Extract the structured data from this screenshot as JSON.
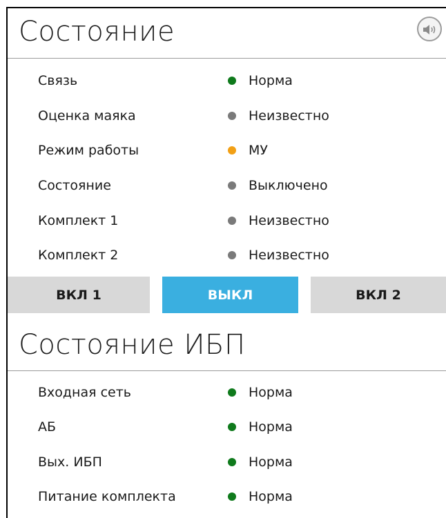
{
  "status_section": {
    "title": "Состояние",
    "rows": [
      {
        "label": "Связь",
        "value": "Норма",
        "state": "ok"
      },
      {
        "label": "Оценка маяка",
        "value": "Неизвестно",
        "state": "unknown"
      },
      {
        "label": "Режим работы",
        "value": "МУ",
        "state": "warn"
      },
      {
        "label": "Состояние",
        "value": "Выключено",
        "state": "unknown"
      },
      {
        "label": "Комплект 1",
        "value": "Неизвестно",
        "state": "unknown"
      },
      {
        "label": "Комплект 2",
        "value": "Неизвестно",
        "state": "unknown"
      }
    ]
  },
  "buttons": {
    "on1": "ВКЛ 1",
    "off": "ВЫКЛ",
    "on2": "ВКЛ 2",
    "active": "off"
  },
  "ups_section": {
    "title": "Состояние ИБП",
    "rows": [
      {
        "label": "Входная сеть",
        "value": "Норма",
        "state": "ok"
      },
      {
        "label": "АБ",
        "value": "Норма",
        "state": "ok"
      },
      {
        "label": "Вых. ИБП",
        "value": "Норма",
        "state": "ok"
      },
      {
        "label": "Питание комплекта",
        "value": "Норма",
        "state": "ok"
      }
    ]
  },
  "icons": {
    "speaker": "speaker-icon"
  },
  "colors": {
    "ok": "#0f7a1c",
    "unknown": "#7a7a7a",
    "warn": "#f2a015",
    "active_button": "#3aafe0",
    "inactive_button": "#d8d8d8"
  }
}
